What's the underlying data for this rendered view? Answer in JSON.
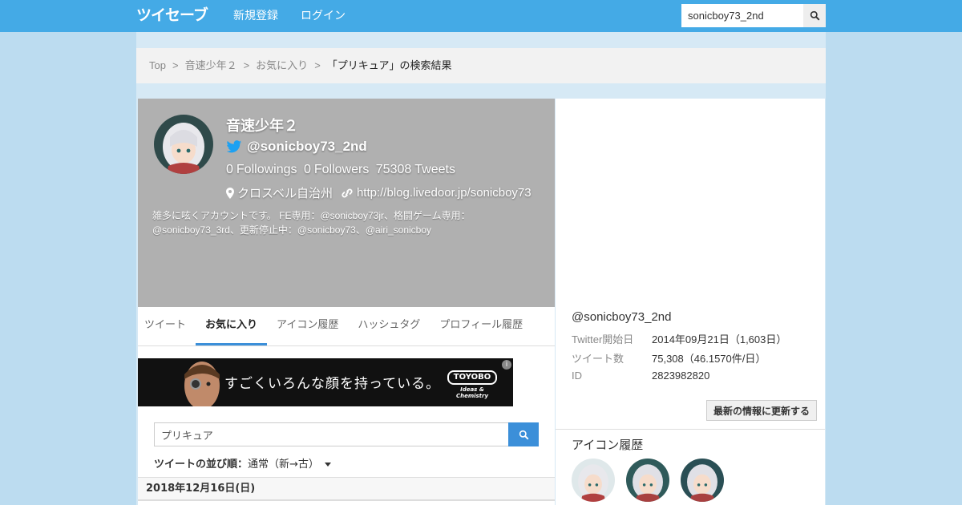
{
  "nav": {
    "logo": "ツイセーブ",
    "signup": "新規登録",
    "login": "ログイン",
    "search_value": "sonicboy73_2nd"
  },
  "breadcrumb": {
    "items": [
      "Top",
      "音速少年２",
      "お気に入り"
    ],
    "sep": ">",
    "current": "「プリキュア」の検索結果"
  },
  "profile": {
    "name": "音速少年２",
    "handle": "@sonicboy73_2nd",
    "followings": "0",
    "followings_label": "Followings",
    "followers": "0",
    "followers_label": "Followers",
    "tweets": "75308",
    "tweets_label": "Tweets",
    "location": "クロスベル自治州",
    "url": "http://blog.livedoor.jp/sonicboy73",
    "bio": "雑多に呟くアカウントです。 FE専用：@sonicboy73jr、格闘ゲーム専用：@sonicboy73_3rd、更新停止中：@sonicboy73、@airi_sonicboy"
  },
  "tabs": [
    "ツイート",
    "お気に入り",
    "アイコン履歴",
    "ハッシュタグ",
    "プロフィール履歴"
  ],
  "ad": {
    "text": "すごくいろんな顔を持っている。",
    "brand": "TOYOBO",
    "brand_sub": "Ideas & Chemistry",
    "info": "i"
  },
  "search": {
    "value": "プリキュア",
    "sort_label": "ツイートの並び順：",
    "sort_value": "通常（新→古）"
  },
  "date_header": "2018年12月16日(日)",
  "side": {
    "handle": "@sonicboy73_2nd",
    "rows": [
      {
        "k": "Twitter開始日",
        "v": "2014年09月21日（1,603日）"
      },
      {
        "k": "ツイート数",
        "v": "75,308（46.1570件/日）"
      },
      {
        "k": "ID",
        "v": "2823982820"
      }
    ],
    "refresh": "最新の情報に更新する",
    "icons_title": "アイコン履歴"
  }
}
